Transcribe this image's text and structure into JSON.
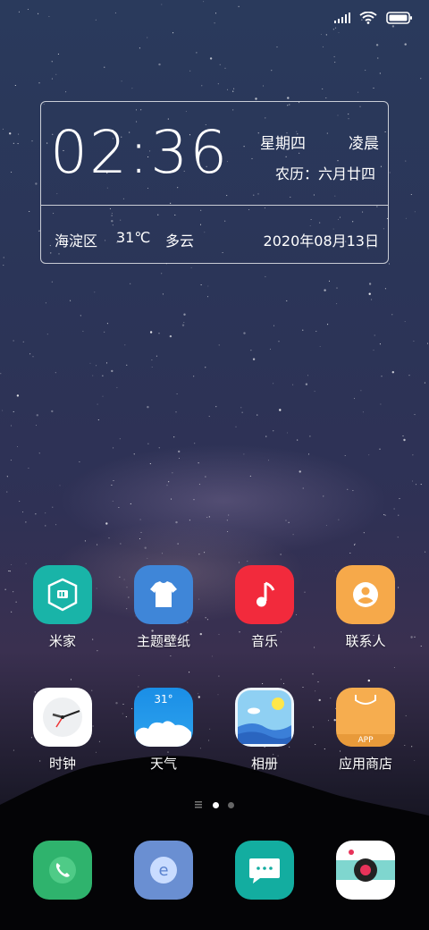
{
  "status_bar": {
    "signal_icon": "signal-bars-icon",
    "wifi_icon": "wifi-icon",
    "battery_icon": "battery-icon"
  },
  "clock_widget": {
    "time": "02:36",
    "weekday": "星期四",
    "period": "凌晨",
    "lunar_date": "农历：六月廿四",
    "location": "海淀区",
    "temperature": "31℃",
    "condition": "多云",
    "date": "2020年08月13日"
  },
  "apps_row1": [
    {
      "label": "米家",
      "icon": "mi-home-icon",
      "color": "#19b4a8"
    },
    {
      "label": "主题壁纸",
      "icon": "theme-shirt-icon",
      "color": "#3f86d8"
    },
    {
      "label": "音乐",
      "icon": "music-note-icon",
      "color": "#f22a3c"
    },
    {
      "label": "联系人",
      "icon": "contacts-person-icon",
      "color": "#f6a94a"
    }
  ],
  "apps_row2": [
    {
      "label": "时钟",
      "icon": "clock-icon",
      "color": "#ffffff"
    },
    {
      "label": "天气",
      "icon": "weather-cloud-icon",
      "color": "#1e95e8",
      "badge": "31°"
    },
    {
      "label": "相册",
      "icon": "gallery-picture-icon",
      "color": "#eef5fb"
    },
    {
      "label": "应用商店",
      "icon": "app-store-bag-icon",
      "color": "#f6ad4f",
      "badge": "APP"
    }
  ],
  "page_indicator": {
    "pages": 2,
    "current": 1
  },
  "dock": [
    {
      "name": "phone",
      "icon": "phone-icon",
      "color": "#2fb36d"
    },
    {
      "name": "browser",
      "icon": "browser-e-icon",
      "color": "#6a8fd2"
    },
    {
      "name": "messages",
      "icon": "message-bubble-icon",
      "color": "#13ada0"
    },
    {
      "name": "camera",
      "icon": "camera-icon",
      "color": "#ffffff"
    }
  ]
}
